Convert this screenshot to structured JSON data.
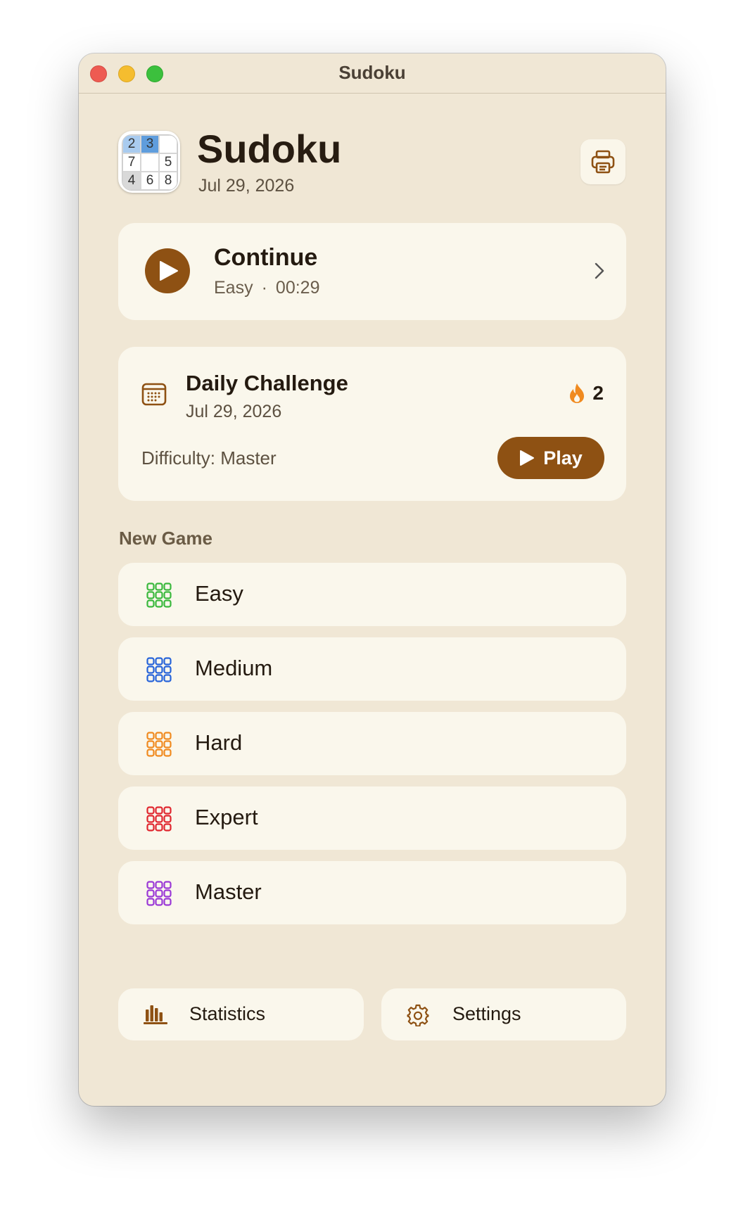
{
  "window": {
    "title": "Sudoku"
  },
  "header": {
    "app_name": "Sudoku",
    "date": "Jul 29, 2026",
    "icon_digits": [
      "2",
      "3",
      "",
      "7",
      "",
      "5",
      "4",
      "6",
      "8"
    ]
  },
  "continue_card": {
    "title": "Continue",
    "difficulty": "Easy",
    "separator": "·",
    "time": "00:29"
  },
  "daily_challenge": {
    "title": "Daily Challenge",
    "date": "Jul 29, 2026",
    "streak": "2",
    "difficulty_text": "Difficulty: Master",
    "play_label": "Play"
  },
  "new_game": {
    "section_label": "New Game",
    "items": [
      {
        "label": "Easy",
        "color": "#3ab83d"
      },
      {
        "label": "Medium",
        "color": "#2663d9"
      },
      {
        "label": "Hard",
        "color": "#f08a1f"
      },
      {
        "label": "Expert",
        "color": "#e0262e"
      },
      {
        "label": "Master",
        "color": "#9a38d6"
      }
    ]
  },
  "bottom": {
    "statistics_label": "Statistics",
    "settings_label": "Settings"
  },
  "colors": {
    "accent": "#8e5113",
    "background": "#f0e7d5",
    "card": "#faf7ec",
    "streak": "#f08a1f"
  }
}
